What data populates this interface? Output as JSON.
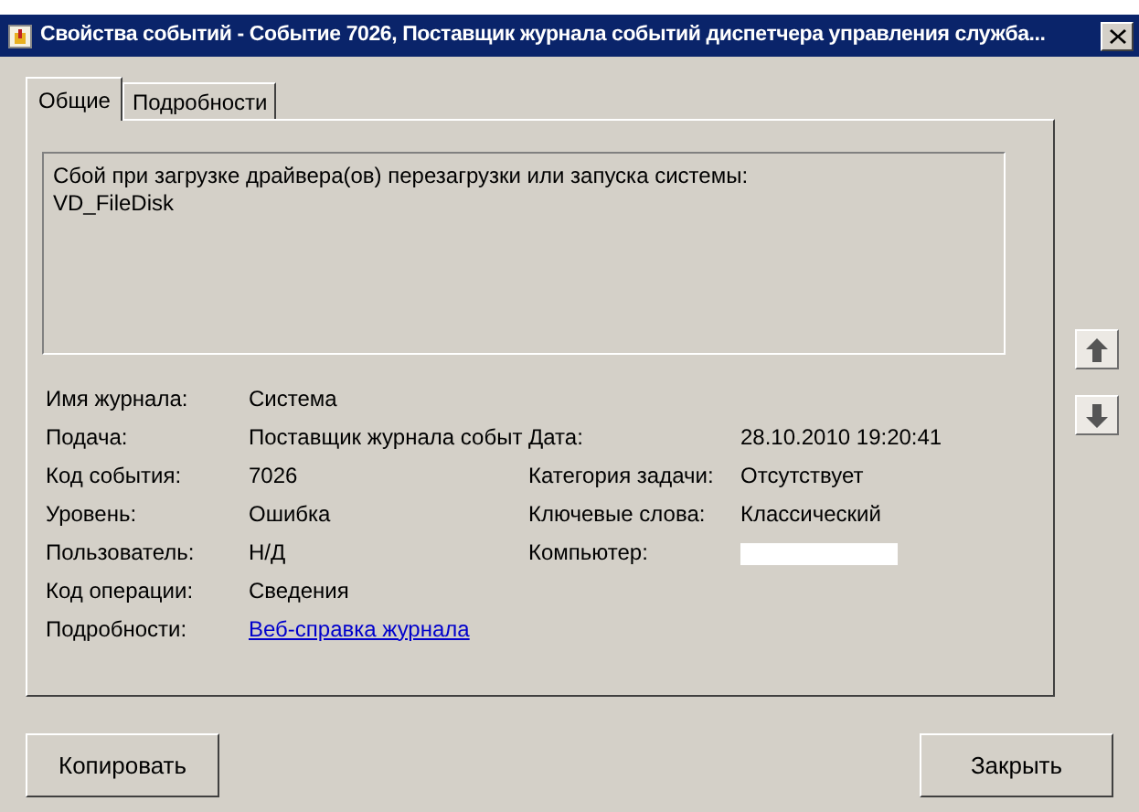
{
  "window": {
    "title": "Свойства событий - Событие 7026, Поставщик журнала событий диспетчера управления служба..."
  },
  "tabs": [
    {
      "label": "Общие",
      "selected": true
    },
    {
      "label": "Подробности",
      "selected": false
    }
  ],
  "description": {
    "lines": [
      "Сбой при загрузке драйвера(ов) перезагрузки или запуска системы:",
      "VD_FileDisk"
    ]
  },
  "fields_left": [
    {
      "label": "Имя журнала:",
      "value": "Система",
      "kind": "text"
    },
    {
      "label": "Подача:",
      "value": "Поставщик журнала событ",
      "kind": "text"
    },
    {
      "label": "Код события:",
      "value": "7026",
      "kind": "text"
    },
    {
      "label": "Уровень:",
      "value": "Ошибка",
      "kind": "text"
    },
    {
      "label": "Пользователь:",
      "value": "Н/Д",
      "kind": "text"
    },
    {
      "label": "Код операции:",
      "value": "Сведения",
      "kind": "text"
    },
    {
      "label": "Подробности:",
      "value": "Веб-справка журнала",
      "kind": "link"
    }
  ],
  "fields_right": [
    {
      "label": "Дата:",
      "value": "28.10.2010 19:20:41",
      "kind": "text"
    },
    {
      "label": "Категория задачи:",
      "value": "Отсутствует",
      "kind": "text"
    },
    {
      "label": "Ключевые слова:",
      "value": "Классический",
      "kind": "text"
    },
    {
      "label": "Компьютер:",
      "kind": "redacted"
    }
  ],
  "buttons": [
    "Копировать",
    "Закрыть"
  ]
}
